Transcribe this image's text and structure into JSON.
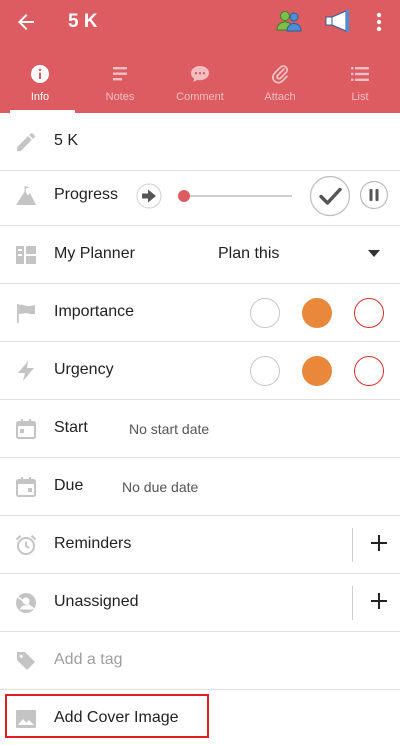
{
  "header": {
    "title": "5 K",
    "tabs": [
      {
        "label": "Info",
        "icon": "info-icon",
        "active": true
      },
      {
        "label": "Notes",
        "icon": "notes-icon",
        "active": false
      },
      {
        "label": "Comment",
        "icon": "comment-icon",
        "active": false
      },
      {
        "label": "Attach",
        "icon": "paperclip-icon",
        "active": false
      },
      {
        "label": "List",
        "icon": "list-icon",
        "active": false
      }
    ]
  },
  "colors": {
    "brand": "#dc5c62",
    "orange": "#e9873a",
    "red_outline": "#d8302a",
    "grey_outline": "#c7c7c7"
  },
  "task": {
    "name": "5 K",
    "progress_label": "Progress",
    "progress_value": 0,
    "planner_label": "My Planner",
    "planner_value": "Plan this",
    "importance_label": "Importance",
    "importance_selected": "medium",
    "urgency_label": "Urgency",
    "urgency_selected": "medium",
    "start_label": "Start",
    "start_value": "No start date",
    "due_label": "Due",
    "due_value": "No due date",
    "reminders_label": "Reminders",
    "assignee_label": "Unassigned",
    "tag_placeholder": "Add a tag",
    "cover_label": "Add Cover Image"
  }
}
